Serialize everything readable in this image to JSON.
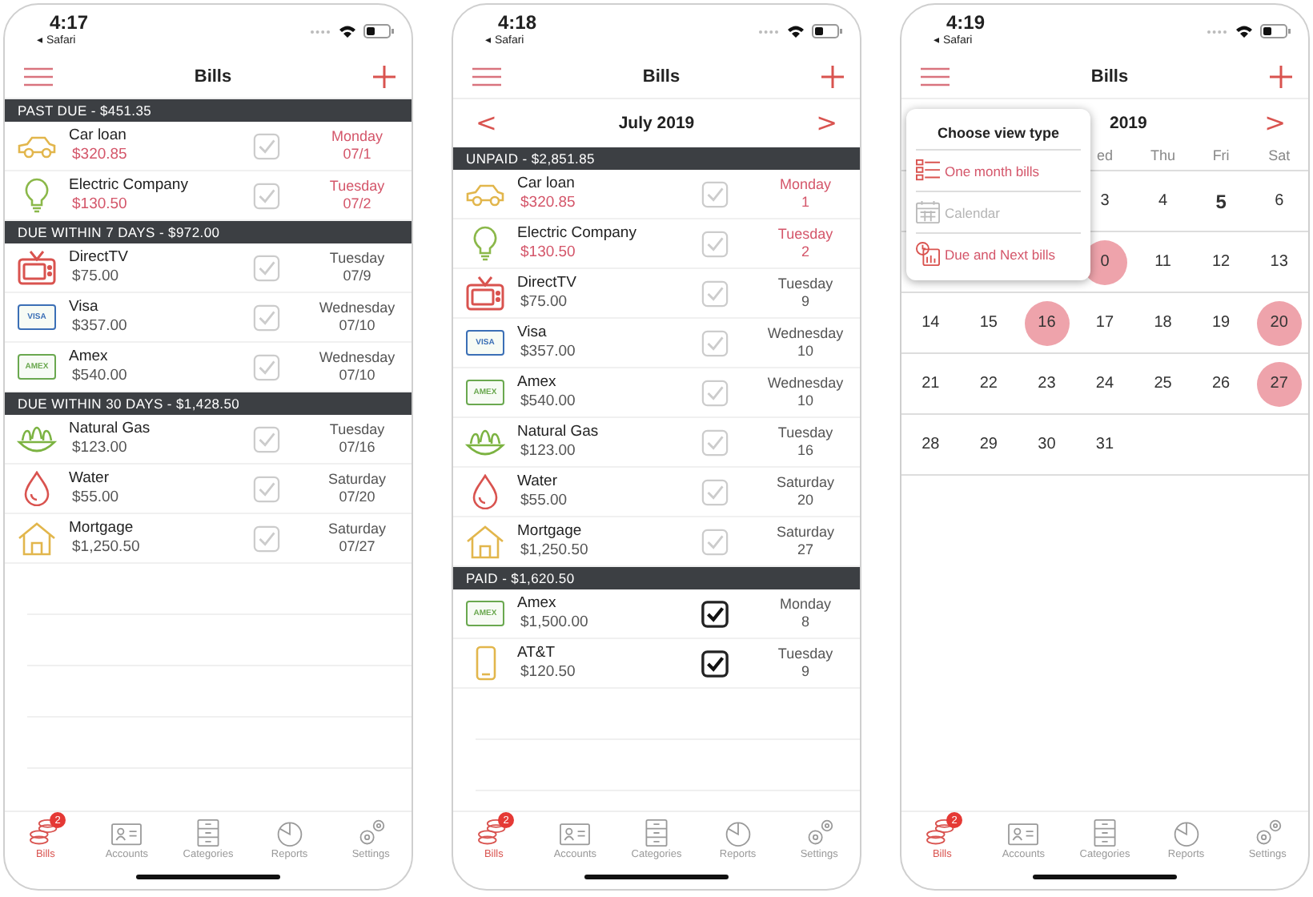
{
  "phones": [
    {
      "kind": "list",
      "time": "4:17",
      "back_label": "◂ Safari",
      "title": "Bills",
      "sections": [
        {
          "header": "PAST DUE - $451.35",
          "bills": [
            {
              "kind": "car",
              "name": "Car loan",
              "amount": "$320.85",
              "overdue": true,
              "checked": false,
              "weekday": "Monday",
              "date": "07/1"
            },
            {
              "kind": "bulb",
              "name": "Electric Company",
              "amount": "$130.50",
              "overdue": true,
              "checked": false,
              "weekday": "Tuesday",
              "date": "07/2"
            }
          ]
        },
        {
          "header": "DUE WITHIN 7 DAYS - $972.00",
          "bills": [
            {
              "kind": "tv",
              "name": "DirectTV",
              "amount": "$75.00",
              "overdue": false,
              "checked": false,
              "weekday": "Tuesday",
              "date": "07/9"
            },
            {
              "kind": "visa_card",
              "brand": "VISA",
              "name": "Visa",
              "amount": "$357.00",
              "overdue": false,
              "checked": false,
              "weekday": "Wednesday",
              "date": "07/10"
            },
            {
              "kind": "amex_card",
              "brand": "AMEX",
              "name": "Amex",
              "amount": "$540.00",
              "overdue": false,
              "checked": false,
              "weekday": "Wednesday",
              "date": "07/10"
            }
          ]
        },
        {
          "header": "DUE WITHIN 30 DAYS - $1,428.50",
          "bills": [
            {
              "kind": "gas",
              "name": "Natural Gas",
              "amount": "$123.00",
              "overdue": false,
              "checked": false,
              "weekday": "Tuesday",
              "date": "07/16"
            },
            {
              "kind": "water",
              "name": "Water",
              "amount": "$55.00",
              "overdue": false,
              "checked": false,
              "weekday": "Saturday",
              "date": "07/20"
            },
            {
              "kind": "house",
              "name": "Mortgage",
              "amount": "$1,250.50",
              "overdue": false,
              "checked": false,
              "weekday": "Saturday",
              "date": "07/27"
            }
          ]
        }
      ],
      "tabs": [
        {
          "kind": "bills",
          "label": "Bills",
          "selected": true,
          "badge": "2"
        },
        {
          "kind": "accounts",
          "label": "Accounts",
          "selected": false
        },
        {
          "kind": "categories",
          "label": "Categories",
          "selected": false
        },
        {
          "kind": "reports",
          "label": "Reports",
          "selected": false
        },
        {
          "kind": "settings",
          "label": "Settings",
          "selected": false
        }
      ]
    },
    {
      "kind": "month",
      "time": "4:18",
      "back_label": "◂ Safari",
      "title": "Bills",
      "prev": "<",
      "month": "July 2019",
      "next": ">",
      "sections": [
        {
          "header": "UNPAID - $2,851.85",
          "bills": [
            {
              "kind": "car",
              "name": "Car loan",
              "amount": "$320.85",
              "overdue": true,
              "checked": false,
              "weekday": "Monday",
              "date": "1"
            },
            {
              "kind": "bulb",
              "name": "Electric Company",
              "amount": "$130.50",
              "overdue": true,
              "checked": false,
              "weekday": "Tuesday",
              "date": "2"
            },
            {
              "kind": "tv",
              "name": "DirectTV",
              "amount": "$75.00",
              "overdue": false,
              "checked": false,
              "weekday": "Tuesday",
              "date": "9"
            },
            {
              "kind": "visa_card",
              "brand": "VISA",
              "name": "Visa",
              "amount": "$357.00",
              "overdue": false,
              "checked": false,
              "weekday": "Wednesday",
              "date": "10"
            },
            {
              "kind": "amex_card",
              "brand": "AMEX",
              "name": "Amex",
              "amount": "$540.00",
              "overdue": false,
              "checked": false,
              "weekday": "Wednesday",
              "date": "10"
            },
            {
              "kind": "gas",
              "name": "Natural Gas",
              "amount": "$123.00",
              "overdue": false,
              "checked": false,
              "weekday": "Tuesday",
              "date": "16"
            },
            {
              "kind": "water",
              "name": "Water",
              "amount": "$55.00",
              "overdue": false,
              "checked": false,
              "weekday": "Saturday",
              "date": "20"
            },
            {
              "kind": "house",
              "name": "Mortgage",
              "amount": "$1,250.50",
              "overdue": false,
              "checked": false,
              "weekday": "Saturday",
              "date": "27"
            }
          ]
        },
        {
          "header": "PAID - $1,620.50",
          "bills": [
            {
              "kind": "amex_card",
              "brand": "AMEX",
              "name": "Amex",
              "amount": "$1,500.00",
              "overdue": false,
              "checked": true,
              "weekday": "Monday",
              "date": "8"
            },
            {
              "kind": "phone",
              "name": "AT&T",
              "amount": "$120.50",
              "overdue": false,
              "checked": true,
              "weekday": "Tuesday",
              "date": "9"
            }
          ]
        }
      ],
      "tabs": [
        {
          "kind": "bills",
          "label": "Bills",
          "selected": true,
          "badge": "2"
        },
        {
          "kind": "accounts",
          "label": "Accounts",
          "selected": false
        },
        {
          "kind": "categories",
          "label": "Categories",
          "selected": false
        },
        {
          "kind": "reports",
          "label": "Reports",
          "selected": false
        },
        {
          "kind": "settings",
          "label": "Settings",
          "selected": false
        }
      ]
    },
    {
      "kind": "calendar",
      "time": "4:19",
      "back_label": "◂ Safari",
      "title": "Bills",
      "month": "2019",
      "next": ">",
      "weekdays": {
        "covered": true,
        "labels": [
          "ed",
          "Thu",
          "Fri",
          "Sat"
        ]
      },
      "weeks": [
        {
          "covered": true,
          "cells": [
            {
              "day": "3",
              "due": false,
              "today": false
            },
            {
              "day": "4",
              "due": false,
              "today": false
            },
            {
              "day": "5",
              "due": false,
              "today": true
            },
            {
              "day": "6",
              "due": false,
              "today": false
            }
          ]
        },
        {
          "covered": true,
          "cells": [
            {
              "day": "0",
              "due": true,
              "today": false
            },
            {
              "day": "11",
              "due": false,
              "today": false
            },
            {
              "day": "12",
              "due": false,
              "today": false
            },
            {
              "day": "13",
              "due": false,
              "today": false
            }
          ]
        },
        {
          "covered": false,
          "cells": [
            {
              "day": "14",
              "due": false,
              "today": false
            },
            {
              "day": "15",
              "due": false,
              "today": false
            },
            {
              "day": "16",
              "due": true,
              "today": false
            },
            {
              "day": "17",
              "due": false,
              "today": false
            },
            {
              "day": "18",
              "due": false,
              "today": false
            },
            {
              "day": "19",
              "due": false,
              "today": false
            },
            {
              "day": "20",
              "due": true,
              "today": false
            }
          ]
        },
        {
          "covered": false,
          "cells": [
            {
              "day": "21",
              "due": false,
              "today": false
            },
            {
              "day": "22",
              "due": false,
              "today": false
            },
            {
              "day": "23",
              "due": false,
              "today": false
            },
            {
              "day": "24",
              "due": false,
              "today": false
            },
            {
              "day": "25",
              "due": false,
              "today": false
            },
            {
              "day": "26",
              "due": false,
              "today": false
            },
            {
              "day": "27",
              "due": true,
              "today": false
            }
          ]
        },
        {
          "covered": false,
          "cells": [
            {
              "day": "28",
              "due": false,
              "today": false
            },
            {
              "day": "29",
              "due": false,
              "today": false
            },
            {
              "day": "30",
              "due": false,
              "today": false
            },
            {
              "day": "31",
              "due": false,
              "today": false
            }
          ]
        }
      ],
      "popover": {
        "title": "Choose view type",
        "items": [
          {
            "kind": "list",
            "label": "One month bills",
            "disabled": false
          },
          {
            "kind": "calendar",
            "label": "Calendar",
            "disabled": true
          },
          {
            "kind": "clock",
            "label": "Due and Next bills",
            "disabled": false
          }
        ]
      },
      "tabs": [
        {
          "kind": "bills",
          "label": "Bills",
          "selected": true,
          "badge": "2"
        },
        {
          "kind": "accounts",
          "label": "Accounts",
          "selected": false
        },
        {
          "kind": "categories",
          "label": "Categories",
          "selected": false
        },
        {
          "kind": "reports",
          "label": "Reports",
          "selected": false
        },
        {
          "kind": "settings",
          "label": "Settings",
          "selected": false
        }
      ]
    }
  ]
}
